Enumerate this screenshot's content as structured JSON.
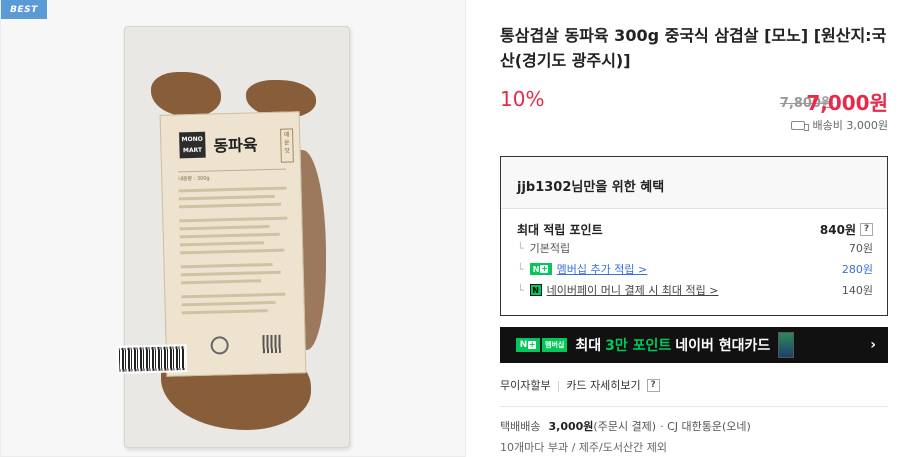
{
  "image": {
    "badge": "BEST",
    "label": {
      "brand_line1": "MONO",
      "brand_line2": "MART",
      "title": "동파육",
      "vertical_tag": "매운맛",
      "weight": "내용량 : 300g"
    }
  },
  "product": {
    "title": "통삼겹살 동파육 300g 중국식 삼겹살 [모노] [원산지:국산(경기도 광주시)]",
    "discount": "10%",
    "original_price": "7,800원",
    "sale_price": "7,000원",
    "shipping_fee": "배송비 3,000원"
  },
  "benefits": {
    "header": "jjb1302님만을 위한 혜택",
    "max_points_label": "최대 적립 포인트",
    "max_points_value": "840원",
    "help": "?",
    "basic_label": "기본적립",
    "basic_value": "70원",
    "membership_label": "멤버십 추가 적립 >",
    "membership_value": "280원",
    "npay_label": "네이버페이 머니 결제 시 최대 적립 >",
    "npay_value": "140원"
  },
  "card_banner": {
    "badge_text": "멤버십",
    "text_prefix": "최대",
    "text_highlight": "3만 포인트",
    "text_suffix": "네이버 현대카드",
    "chevron": "›"
  },
  "payment": {
    "installment": "무이자할부",
    "card_detail": "카드 자세히보기",
    "help": "?"
  },
  "delivery": {
    "type": "택배배송",
    "fee": "3,000원",
    "fee_note": "(주문시 결제)",
    "carrier": "· CJ 대한통운(오네)",
    "note": "10개마다 부과 / 제주/도서산간 제외"
  },
  "colors": {
    "accent_red": "#e8294a",
    "naver_green": "#03c75a",
    "badge_blue": "#5b9bd5"
  }
}
